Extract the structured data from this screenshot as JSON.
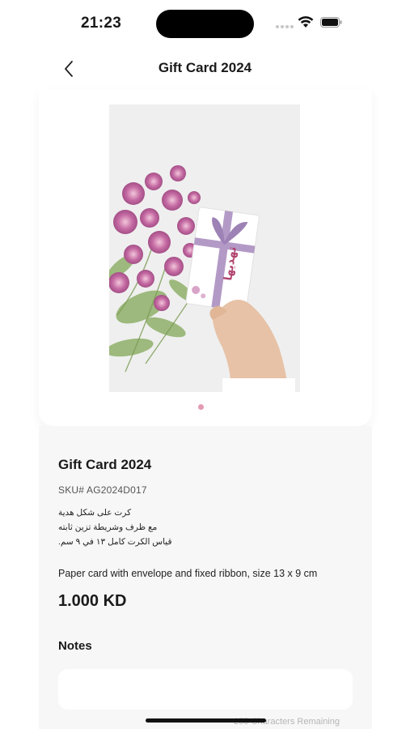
{
  "status_bar": {
    "time": "21:23",
    "icons": [
      "cellular-dots-icon",
      "wifi-icon",
      "battery-icon"
    ]
  },
  "header": {
    "title": "Gift Card 2024",
    "back_icon": "chevron-left-icon"
  },
  "gallery": {
    "image_alt": "Gift card held in hand beside pink flowers",
    "card_text": "تهديها",
    "page_count": 1,
    "active_page": 1,
    "dot_color": "#e39bb2"
  },
  "product": {
    "name": "Gift Card 2024",
    "sku": "SKU# AG2024D017",
    "arabic_lines": [
      "كرت على شكل هدية",
      "مع ظرف وشريطة تزين ثابته",
      "قياس الكرت كامل ١٣ في ٩ سم."
    ],
    "description": "Paper card with envelope and fixed ribbon, size 13 x 9 cm",
    "price": "1.000 KD"
  },
  "notes": {
    "label": "Notes",
    "value": "",
    "placeholder": "",
    "remaining_text": "255 Characters Remaining"
  }
}
